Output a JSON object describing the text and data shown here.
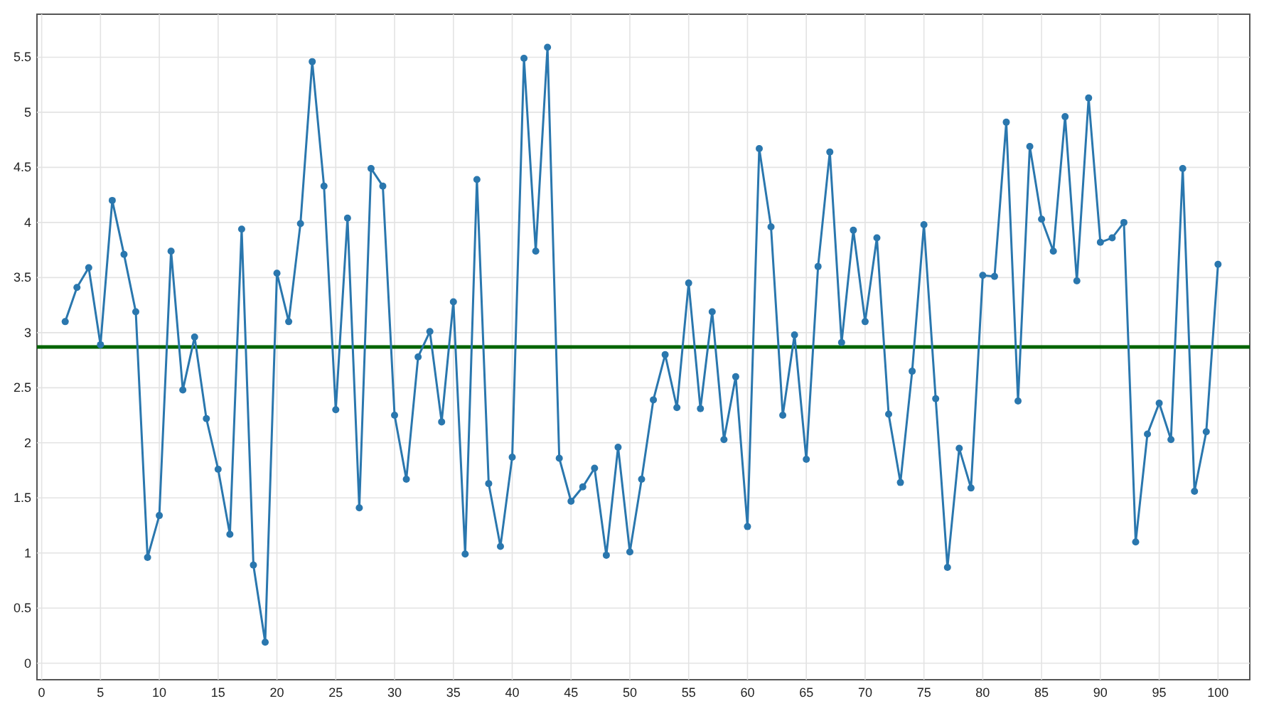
{
  "chart": {
    "chart_data": {
      "type": "line",
      "x": [
        2,
        3,
        4,
        5,
        6,
        7,
        8,
        9,
        10,
        11,
        12,
        13,
        14,
        15,
        16,
        17,
        18,
        19,
        20,
        21,
        22,
        23,
        24,
        25,
        26,
        27,
        28,
        29,
        30,
        31,
        32,
        33,
        34,
        35,
        36,
        37,
        38,
        39,
        40,
        41,
        42,
        43,
        44,
        45,
        46,
        47,
        48,
        49,
        50,
        51,
        52,
        53,
        54,
        55,
        56,
        57,
        58,
        59,
        60,
        61,
        62,
        63,
        64,
        65,
        66,
        67,
        68,
        69,
        70,
        71,
        72,
        73,
        74,
        75,
        76,
        77,
        78,
        79,
        80,
        81,
        82,
        83,
        84,
        85,
        86,
        87,
        88,
        89,
        90,
        91,
        92,
        93,
        94,
        95,
        96,
        97,
        98,
        99,
        100
      ],
      "grid": true,
      "series": [
        {
          "color": "#2a77ae",
          "marker": "o",
          "values": [
            3.1,
            3.41,
            3.59,
            2.89,
            4.2,
            3.71,
            3.19,
            0.96,
            1.34,
            3.74,
            2.48,
            2.96,
            2.22,
            1.76,
            1.17,
            3.94,
            0.89,
            0.19,
            3.54,
            3.1,
            3.99,
            5.46,
            4.33,
            2.3,
            4.04,
            1.41,
            4.49,
            4.33,
            2.25,
            1.67,
            2.78,
            3.01,
            2.19,
            3.28,
            0.99,
            4.39,
            1.63,
            1.06,
            1.87,
            5.49,
            3.74,
            5.59,
            1.86,
            1.47,
            1.6,
            1.77,
            0.98,
            1.96,
            1.01,
            1.67,
            2.39,
            2.8,
            2.32,
            3.45,
            2.31,
            3.19,
            2.03,
            2.6,
            1.24,
            4.67,
            3.96,
            2.25,
            2.98,
            1.85,
            3.6,
            4.64,
            2.91,
            3.93,
            3.1,
            3.86,
            2.26,
            1.64,
            2.65,
            3.98,
            2.4,
            0.87,
            1.95,
            1.59,
            3.52,
            3.51,
            4.91,
            2.38,
            4.69,
            4.03,
            3.74,
            4.96,
            3.47,
            5.13,
            3.82,
            3.86,
            4.0,
            1.1,
            2.08,
            2.36,
            2.03,
            4.49,
            1.56,
            2.1,
            3.62
          ]
        }
      ],
      "xlim": [
        -0.4,
        102.7
      ],
      "ylim": [
        -0.15,
        5.89
      ],
      "xticks": [
        0,
        5,
        10,
        15,
        20,
        25,
        30,
        35,
        40,
        45,
        50,
        55,
        60,
        65,
        70,
        75,
        80,
        85,
        90,
        95,
        100
      ],
      "yticks": [
        0,
        0.5,
        1,
        1.5,
        2,
        2.5,
        3,
        3.5,
        4,
        4.5,
        5,
        5.5
      ],
      "ref_lines": [
        {
          "axis": "y",
          "value": 2.87,
          "color": "#006400"
        }
      ]
    }
  }
}
